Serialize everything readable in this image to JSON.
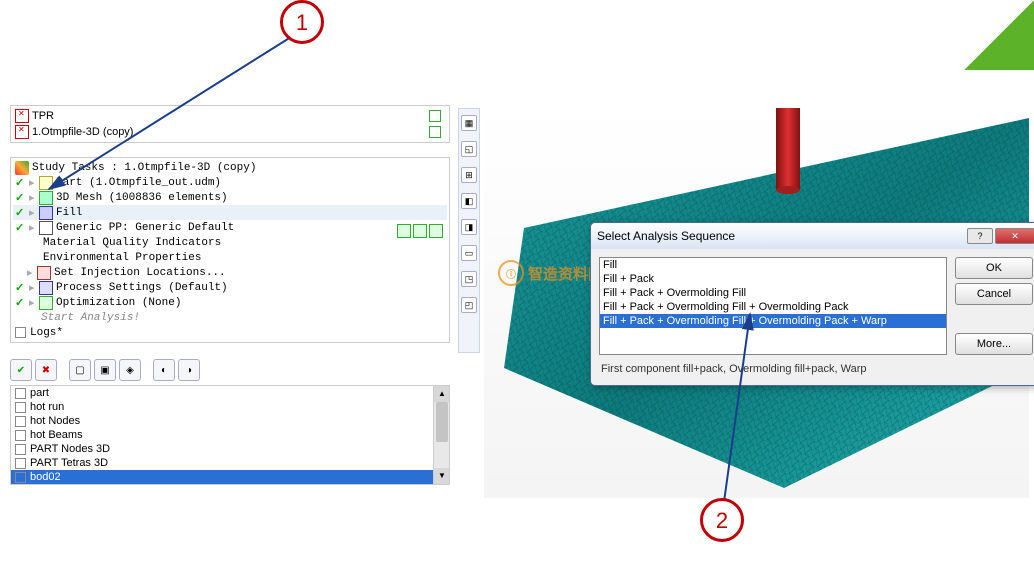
{
  "callouts": {
    "c1": "1",
    "c2": "2"
  },
  "files": [
    {
      "name": "TPR"
    },
    {
      "name": "1.Otmpfile-3D (copy)"
    }
  ],
  "study": {
    "title": "Study Tasks : 1.Otmpfile-3D (copy)",
    "part": "Part (1.Otmpfile_out.udm)",
    "mesh": "3D Mesh (1008836 elements)",
    "fill": "Fill",
    "generic": "Generic PP: Generic Default",
    "mqi": "Material Quality Indicators",
    "env": "Environmental Properties",
    "inj": "Set Injection Locations...",
    "proc": "Process Settings (Default)",
    "opt": "Optimization (None)",
    "start": "Start Analysis!",
    "logs": "Logs*"
  },
  "layers": [
    "part",
    "hot run",
    "hot Nodes",
    "hot Beams",
    "PART Nodes 3D",
    "PART Tetras 3D",
    "bod02"
  ],
  "dialog": {
    "title": "Select Analysis Sequence",
    "ok": "OK",
    "cancel": "Cancel",
    "more": "More...",
    "items": [
      "Fill",
      "Fill + Pack",
      "Fill + Pack + Overmolding Fill",
      "Fill + Pack + Overmolding Fill + Overmolding Pack",
      "Fill + Pack + Overmolding Fill + Overmolding Pack + Warp"
    ],
    "desc": "First component fill+pack, Overmolding fill+pack, Warp"
  },
  "watermark": "智造资料网"
}
